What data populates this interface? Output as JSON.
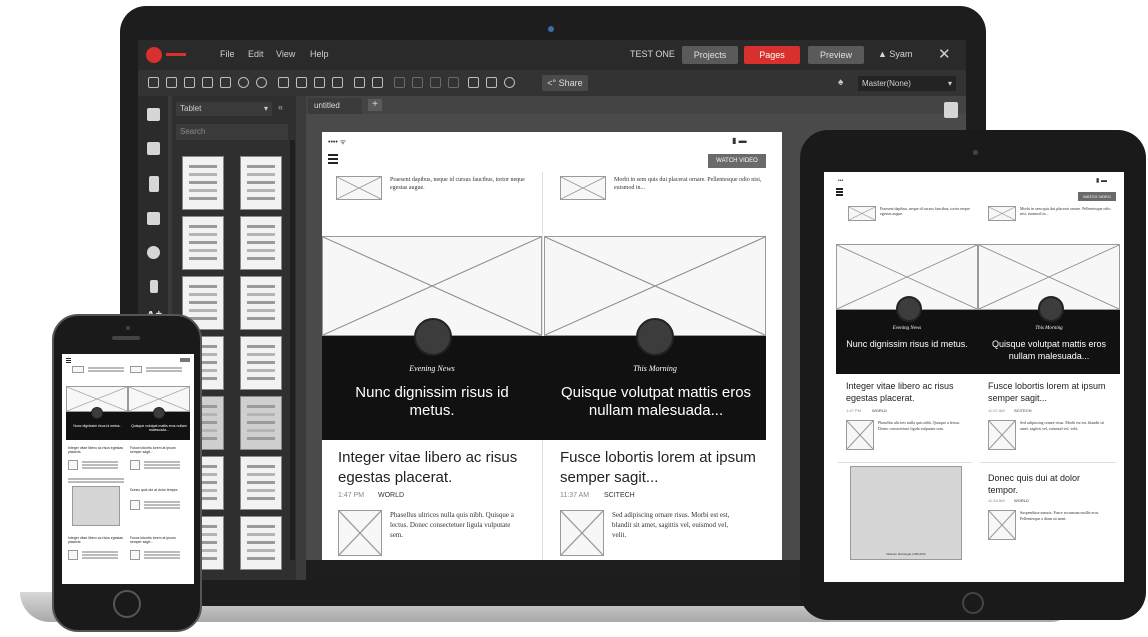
{
  "app": {
    "menu": [
      "File",
      "Edit",
      "View",
      "Help"
    ],
    "project_name": "TEST ONE",
    "buttons": {
      "projects": "Projects",
      "pages": "Pages",
      "preview": "Preview"
    },
    "user": "Syam",
    "share_label": "Share",
    "master_select": "Master(None)",
    "device_select": "Tablet",
    "search_placeholder": "Search",
    "tab_label": "untitled"
  },
  "wireframe": {
    "watch_label": "WATCH VIDEO",
    "top_text_left": "Praesent dapibus, neque id cursus faucibus, tortor neque egestas augue.",
    "top_text_right": "Morbi in sem quis dui placerat ornare. Pellentesque odio nisi, euismod in...",
    "hero_left": {
      "kicker": "Evening News",
      "title": "Nunc dignissim risus id metus."
    },
    "hero_right": {
      "kicker": "This Morning",
      "title": "Quisque volutpat mattis eros nullam malesuada..."
    },
    "story_left": {
      "title": "Integer vitae libero ac risus egestas placerat.",
      "time": "1:47 PM",
      "tag": "WORLD",
      "body": "Phasellus ultrices nulla quis nibh. Quisque a lectus. Donec consectetuer ligula vulputate sem."
    },
    "story_right": {
      "title": "Fusce lobortis lorem at ipsum semper sagit...",
      "time": "11:37 AM",
      "tag": "SCITECH",
      "body": "Sed adipiscing ornare risus. Morbi est est, blandit sit amet, sagittis vel, euismod vel, velit."
    },
    "story_third": {
      "title": "Donec quis dui at dolor tempor.",
      "time": "11:34 AM",
      "tag": "WORLD",
      "body": "Suspendisse mauris. Fusce accumsan mollis eros. Pellentesque a diam sit amet."
    },
    "ad_caption": "Medium Rectangle (300x250)"
  },
  "colors": {
    "accent_red": "#d8302c",
    "chrome_dark": "#2a2a2a",
    "hero_black": "#111111"
  }
}
